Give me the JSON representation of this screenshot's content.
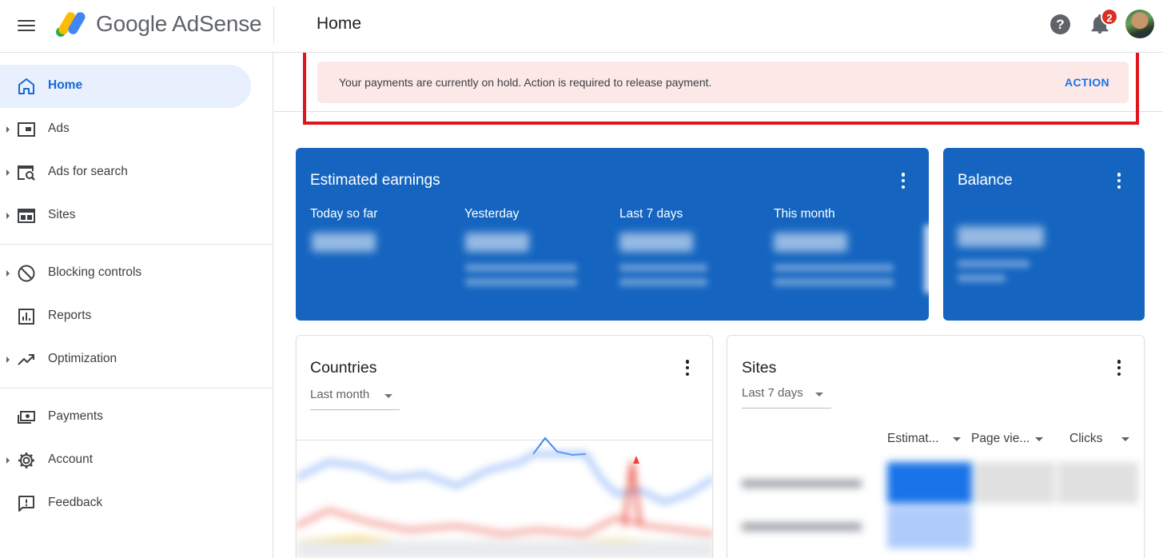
{
  "app": {
    "brand": "Google AdSense",
    "page_title": "Home",
    "notification_count": "2"
  },
  "sidebar": {
    "items": [
      {
        "label": "Home",
        "icon": "home-icon",
        "active": true,
        "expandable": false
      },
      {
        "label": "Ads",
        "icon": "ads-icon",
        "expandable": true
      },
      {
        "label": "Ads for search",
        "icon": "ads-for-search-icon",
        "expandable": true
      },
      {
        "label": "Sites",
        "icon": "sites-icon",
        "expandable": true
      },
      {
        "label": "Blocking controls",
        "icon": "block-icon",
        "expandable": true
      },
      {
        "label": "Reports",
        "icon": "reports-icon",
        "expandable": false
      },
      {
        "label": "Optimization",
        "icon": "trending-up-icon",
        "expandable": true
      },
      {
        "label": "Payments",
        "icon": "payments-icon",
        "expandable": false
      },
      {
        "label": "Account",
        "icon": "gear-icon",
        "expandable": true
      },
      {
        "label": "Feedback",
        "icon": "feedback-icon",
        "expandable": false
      }
    ]
  },
  "alert": {
    "message": "Your payments are currently on hold. Action is required to release payment.",
    "action_label": "ACTION"
  },
  "earnings": {
    "title": "Estimated earnings",
    "stats": [
      {
        "label": "Today so far"
      },
      {
        "label": "Yesterday"
      },
      {
        "label": "Last 7 days"
      },
      {
        "label": "This month"
      }
    ]
  },
  "balance": {
    "title": "Balance"
  },
  "countries": {
    "title": "Countries",
    "range": "Last month"
  },
  "sites": {
    "title": "Sites",
    "range": "Last 7 days",
    "columns": [
      "Estimat...",
      "Page vie...",
      "Clicks"
    ]
  },
  "colors": {
    "accent": "#1a73e8",
    "card_blue": "#1565c0",
    "alert_bg": "#fce8e6",
    "highlight_box": "#e0151b",
    "nav_active_bg": "#e8f0fe"
  }
}
